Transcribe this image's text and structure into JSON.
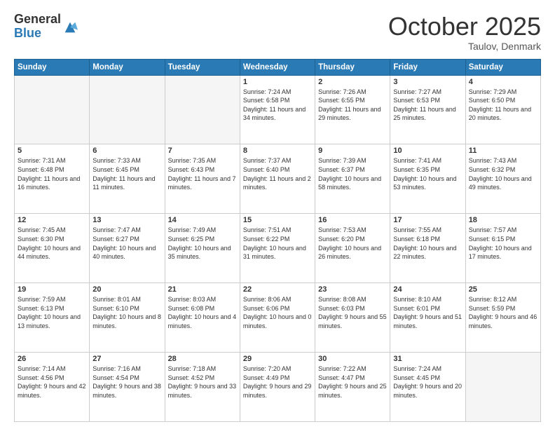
{
  "logo": {
    "general": "General",
    "blue": "Blue"
  },
  "header": {
    "month": "October 2025",
    "location": "Taulov, Denmark"
  },
  "days_of_week": [
    "Sunday",
    "Monday",
    "Tuesday",
    "Wednesday",
    "Thursday",
    "Friday",
    "Saturday"
  ],
  "weeks": [
    [
      {
        "day": "",
        "empty": true
      },
      {
        "day": "",
        "empty": true
      },
      {
        "day": "",
        "empty": true
      },
      {
        "day": "1",
        "sunrise": "7:24 AM",
        "sunset": "6:58 PM",
        "daylight": "11 hours and 34 minutes."
      },
      {
        "day": "2",
        "sunrise": "7:26 AM",
        "sunset": "6:55 PM",
        "daylight": "11 hours and 29 minutes."
      },
      {
        "day": "3",
        "sunrise": "7:27 AM",
        "sunset": "6:53 PM",
        "daylight": "11 hours and 25 minutes."
      },
      {
        "day": "4",
        "sunrise": "7:29 AM",
        "sunset": "6:50 PM",
        "daylight": "11 hours and 20 minutes."
      }
    ],
    [
      {
        "day": "5",
        "sunrise": "7:31 AM",
        "sunset": "6:48 PM",
        "daylight": "11 hours and 16 minutes."
      },
      {
        "day": "6",
        "sunrise": "7:33 AM",
        "sunset": "6:45 PM",
        "daylight": "11 hours and 11 minutes."
      },
      {
        "day": "7",
        "sunrise": "7:35 AM",
        "sunset": "6:43 PM",
        "daylight": "11 hours and 7 minutes."
      },
      {
        "day": "8",
        "sunrise": "7:37 AM",
        "sunset": "6:40 PM",
        "daylight": "11 hours and 2 minutes."
      },
      {
        "day": "9",
        "sunrise": "7:39 AM",
        "sunset": "6:37 PM",
        "daylight": "10 hours and 58 minutes."
      },
      {
        "day": "10",
        "sunrise": "7:41 AM",
        "sunset": "6:35 PM",
        "daylight": "10 hours and 53 minutes."
      },
      {
        "day": "11",
        "sunrise": "7:43 AM",
        "sunset": "6:32 PM",
        "daylight": "10 hours and 49 minutes."
      }
    ],
    [
      {
        "day": "12",
        "sunrise": "7:45 AM",
        "sunset": "6:30 PM",
        "daylight": "10 hours and 44 minutes."
      },
      {
        "day": "13",
        "sunrise": "7:47 AM",
        "sunset": "6:27 PM",
        "daylight": "10 hours and 40 minutes."
      },
      {
        "day": "14",
        "sunrise": "7:49 AM",
        "sunset": "6:25 PM",
        "daylight": "10 hours and 35 minutes."
      },
      {
        "day": "15",
        "sunrise": "7:51 AM",
        "sunset": "6:22 PM",
        "daylight": "10 hours and 31 minutes."
      },
      {
        "day": "16",
        "sunrise": "7:53 AM",
        "sunset": "6:20 PM",
        "daylight": "10 hours and 26 minutes."
      },
      {
        "day": "17",
        "sunrise": "7:55 AM",
        "sunset": "6:18 PM",
        "daylight": "10 hours and 22 minutes."
      },
      {
        "day": "18",
        "sunrise": "7:57 AM",
        "sunset": "6:15 PM",
        "daylight": "10 hours and 17 minutes."
      }
    ],
    [
      {
        "day": "19",
        "sunrise": "7:59 AM",
        "sunset": "6:13 PM",
        "daylight": "10 hours and 13 minutes."
      },
      {
        "day": "20",
        "sunrise": "8:01 AM",
        "sunset": "6:10 PM",
        "daylight": "10 hours and 8 minutes."
      },
      {
        "day": "21",
        "sunrise": "8:03 AM",
        "sunset": "6:08 PM",
        "daylight": "10 hours and 4 minutes."
      },
      {
        "day": "22",
        "sunrise": "8:06 AM",
        "sunset": "6:06 PM",
        "daylight": "10 hours and 0 minutes."
      },
      {
        "day": "23",
        "sunrise": "8:08 AM",
        "sunset": "6:03 PM",
        "daylight": "9 hours and 55 minutes."
      },
      {
        "day": "24",
        "sunrise": "8:10 AM",
        "sunset": "6:01 PM",
        "daylight": "9 hours and 51 minutes."
      },
      {
        "day": "25",
        "sunrise": "8:12 AM",
        "sunset": "5:59 PM",
        "daylight": "9 hours and 46 minutes."
      }
    ],
    [
      {
        "day": "26",
        "sunrise": "7:14 AM",
        "sunset": "4:56 PM",
        "daylight": "9 hours and 42 minutes."
      },
      {
        "day": "27",
        "sunrise": "7:16 AM",
        "sunset": "4:54 PM",
        "daylight": "9 hours and 38 minutes."
      },
      {
        "day": "28",
        "sunrise": "7:18 AM",
        "sunset": "4:52 PM",
        "daylight": "9 hours and 33 minutes."
      },
      {
        "day": "29",
        "sunrise": "7:20 AM",
        "sunset": "4:49 PM",
        "daylight": "9 hours and 29 minutes."
      },
      {
        "day": "30",
        "sunrise": "7:22 AM",
        "sunset": "4:47 PM",
        "daylight": "9 hours and 25 minutes."
      },
      {
        "day": "31",
        "sunrise": "7:24 AM",
        "sunset": "4:45 PM",
        "daylight": "9 hours and 20 minutes."
      },
      {
        "day": "",
        "empty": true
      }
    ]
  ]
}
